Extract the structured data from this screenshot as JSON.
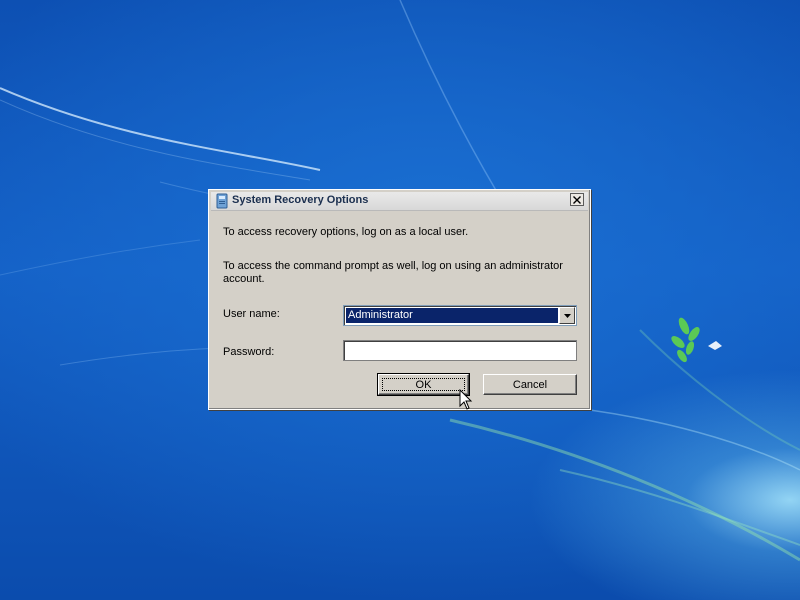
{
  "dialog": {
    "title": "System Recovery Options",
    "title_icon": "recovery-drive-icon",
    "close_icon": "close-icon",
    "line1": "To access recovery options, log on as a local user.",
    "line2": "To access the command prompt as well, log on using an administrator",
    "line3": "account.",
    "username_label": "User name:",
    "username_value": "Administrator",
    "password_label": "Password:",
    "password_value": "",
    "ok_label": "OK",
    "cancel_label": "Cancel"
  },
  "icons": {
    "dropdown": "chevron-down-icon",
    "cursor": "mouse-pointer-icon"
  },
  "colors": {
    "selection_bg": "#0a246a",
    "dialog_bg": "#d4d0c8",
    "desktop_blue": "#1460c6"
  }
}
